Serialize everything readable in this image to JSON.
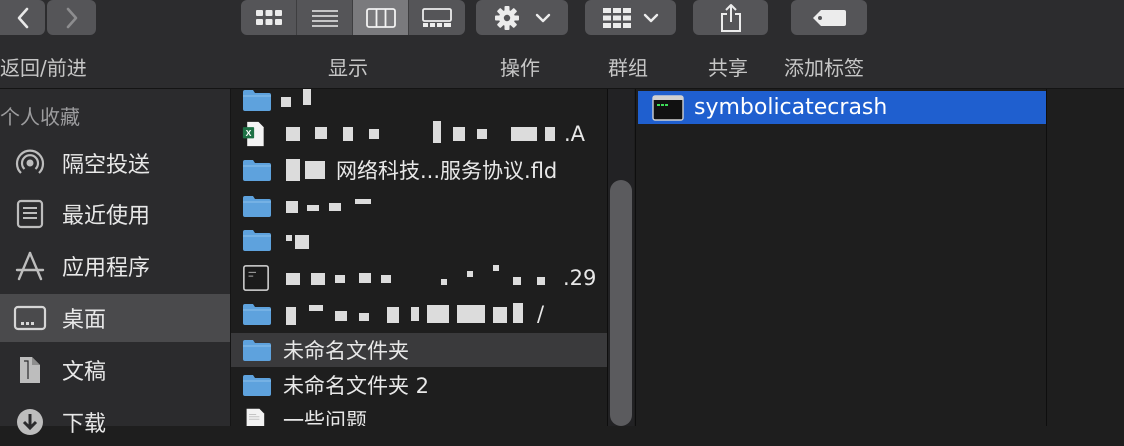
{
  "toolbar": {
    "nav_label": "返回/前进",
    "view_label": "显示",
    "action_label": "操作",
    "group_label": "群组",
    "share_label": "共享",
    "tags_label": "添加标签",
    "icons": [
      "chevron-left-icon",
      "chevron-right-icon",
      "grid-view-icon",
      "list-view-icon",
      "column-view-icon",
      "gallery-view-icon",
      "gear-icon",
      "group-grid-icon",
      "share-icon",
      "tag-icon"
    ]
  },
  "sidebar": {
    "section": "个人收藏",
    "items": [
      {
        "label": "隔空投送",
        "icon": "airdrop-icon"
      },
      {
        "label": "最近使用",
        "icon": "recents-icon"
      },
      {
        "label": "应用程序",
        "icon": "applications-icon"
      },
      {
        "label": "桌面",
        "icon": "desktop-icon",
        "selected": true
      },
      {
        "label": "文稿",
        "icon": "documents-icon"
      },
      {
        "label": "下载",
        "icon": "downloads-icon"
      }
    ]
  },
  "column1": {
    "items": [
      {
        "name": "",
        "icon": "folder-icon"
      },
      {
        "name": ".A",
        "icon": "excel-file-icon"
      },
      {
        "name": "网络科技...服务协议.fld",
        "icon": "folder-icon"
      },
      {
        "name": "",
        "icon": "folder-icon"
      },
      {
        "name": "",
        "icon": "folder-icon"
      },
      {
        "name": ".29",
        "icon": "terminal-file-icon"
      },
      {
        "name": "/",
        "icon": "folder-icon"
      },
      {
        "name": "未命名文件夹",
        "icon": "folder-icon",
        "selected": true
      },
      {
        "name": "未命名文件夹 2",
        "icon": "folder-icon"
      },
      {
        "name": "一些问题",
        "icon": "document-icon"
      }
    ]
  },
  "column2": {
    "selected_item": "symbolicatecrash",
    "selected_icon": "terminal-exec-icon"
  },
  "colors": {
    "selection": "#1f5fcf",
    "folder": "#5ea2dd"
  }
}
